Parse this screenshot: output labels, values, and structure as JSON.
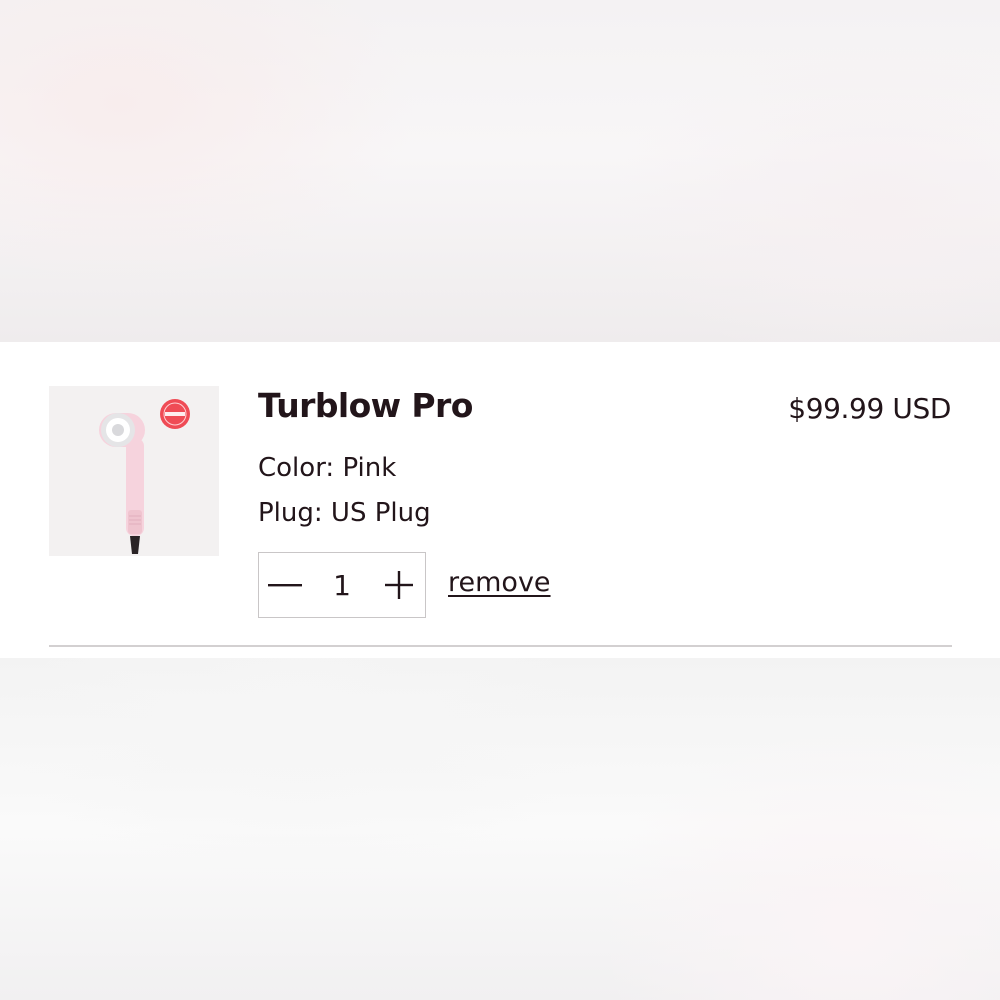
{
  "cart_item": {
    "name": "Turblow Pro",
    "price": "$99.99 USD",
    "options": {
      "color": "Color: Pink",
      "plug": "Plug: US Plug"
    },
    "quantity": "1",
    "remove_label": "remove",
    "image": {
      "icon": "hair-dryer-product-image",
      "badge_icon": "red-award-badge-icon",
      "accent_color": "#f6d3dd",
      "badge_color": "#ef4b55"
    }
  },
  "icons": {
    "decrease": "minus-icon",
    "increase": "plus-icon"
  }
}
